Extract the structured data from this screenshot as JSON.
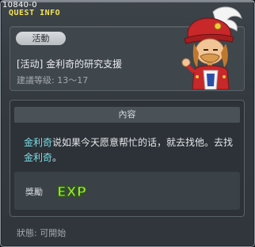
{
  "window": {
    "quest_id": "10840-0",
    "title": "QUEST INFO"
  },
  "quest": {
    "badge": "活動",
    "name": "[活动] 金利奇的研究支援",
    "level": "建議等级: 13～17"
  },
  "content": {
    "header": "內容",
    "desc_part1": "金利奇",
    "desc_part2": "说如果今天愿意帮忙的话，就去找他。去找",
    "desc_part3": "金利奇",
    "desc_part4": "。"
  },
  "reward": {
    "label": "獎勵",
    "exp_text": "EXP"
  },
  "status": {
    "text": "狀態: 可開始"
  },
  "colors": {
    "title": "#f2e35b",
    "highlight": "#7cdfe8",
    "exp_green": "#9be83a"
  },
  "icons": {
    "npc": "npc-pirate-portrait-icon",
    "exp": "exp-icon"
  }
}
